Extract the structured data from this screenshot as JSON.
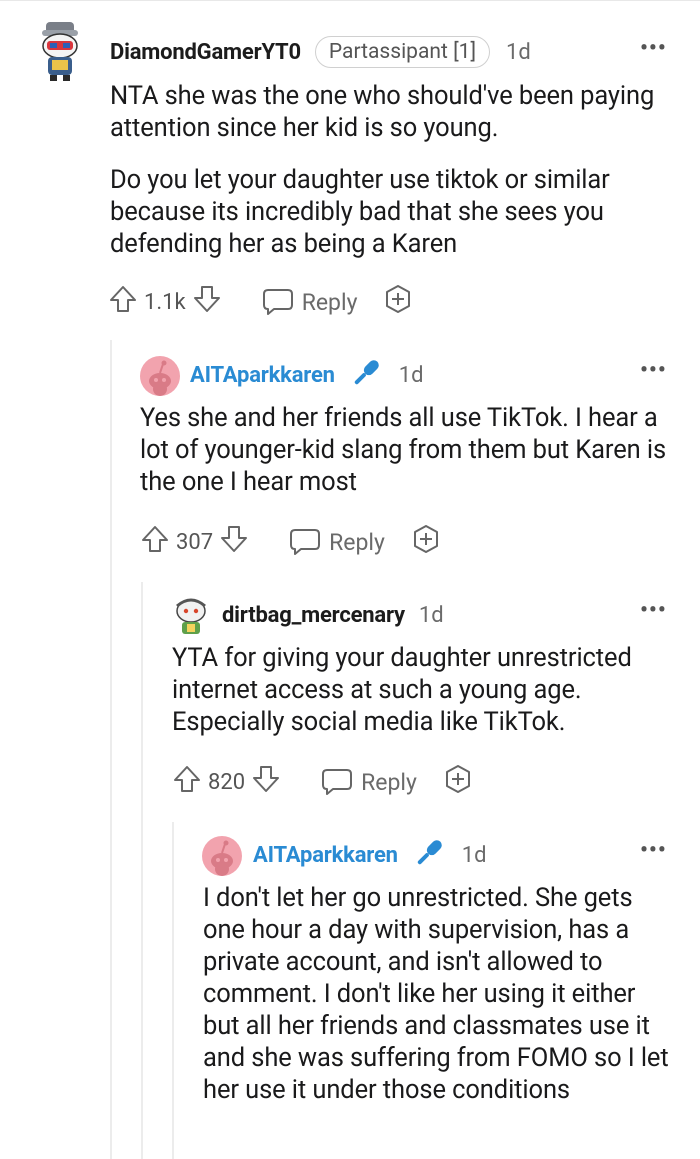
{
  "comments": [
    {
      "username": "DiamondGamerYT0",
      "flair": "Partassipant [1]",
      "age": "1d",
      "paragraphs": [
        "NTA she was the one who should've been paying attention since her kid is so young.",
        "Do you let your daughter use tiktok or similar because its incredibly bad that she sees you defending her as being a Karen"
      ],
      "votes": "1.1k",
      "reply_label": "Reply"
    },
    {
      "username": "AITAparkkaren",
      "age": "1d",
      "paragraphs": [
        "Yes she and her friends all use TikTok. I hear a lot of younger-kid slang from them but Karen is the one I hear most"
      ],
      "votes": "307",
      "reply_label": "Reply"
    },
    {
      "username": "dirtbag_mercenary",
      "age": "1d",
      "paragraphs": [
        "YTA for giving your daughter unrestricted internet access at such a young age. Especially social media like TikTok."
      ],
      "votes": "820",
      "reply_label": "Reply"
    },
    {
      "username": "AITAparkkaren",
      "age": "1d",
      "paragraphs": [
        "I don't let her go unrestricted. She gets one hour a day with supervision, has a private account, and isn't allowed to comment. I don't like her using it either but all her friends and classmates use it and she was suffering from FOMO so I let her use it under those conditions"
      ]
    }
  ],
  "more_label": "•••",
  "colors": {
    "op_username": "#2a8bd3",
    "mic_icon": "#2a8bd3",
    "pink_avatar": "#f2a3ae"
  }
}
